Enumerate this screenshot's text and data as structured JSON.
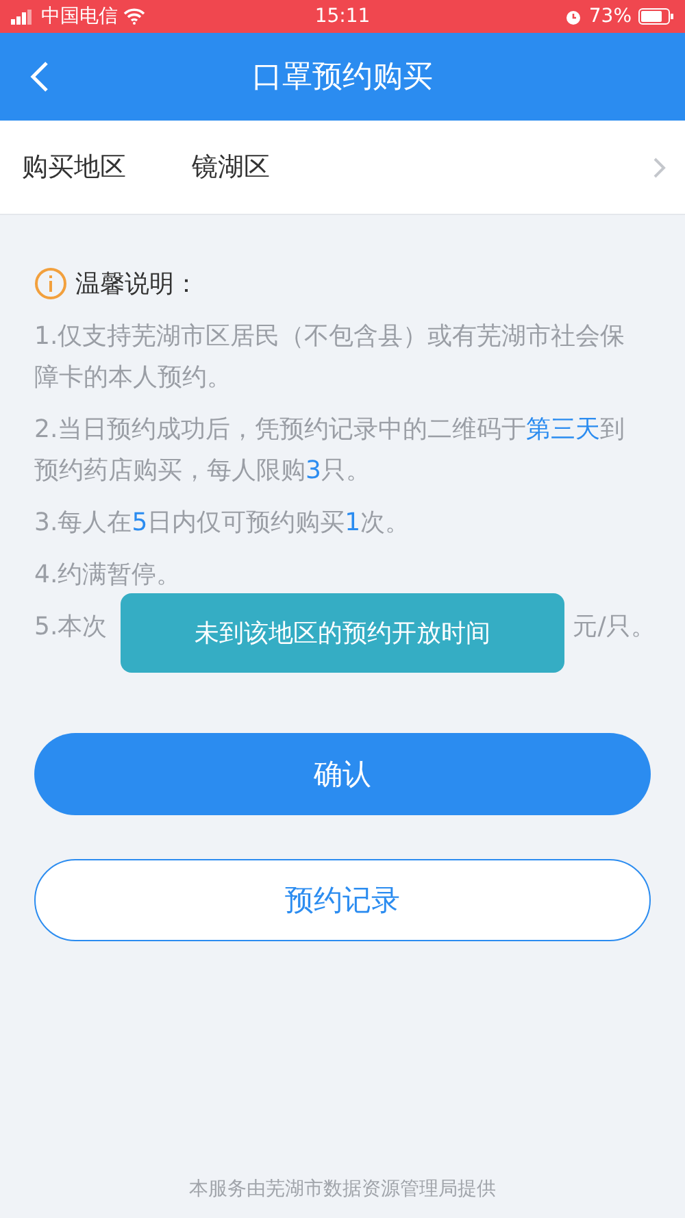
{
  "status_bar": {
    "carrier": "中国电信",
    "time": "15:11",
    "battery": "73%"
  },
  "nav_bar": {
    "title": "口罩预约购买"
  },
  "region_row": {
    "label": "购买地区",
    "value": "镜湖区"
  },
  "notice": {
    "title": "温馨说明：",
    "items": [
      {
        "segments": [
          {
            "text": "1.仅支持芜湖市区居民（不包含县）或有芜湖市社会保障卡的本人预约。",
            "highlight": false
          }
        ]
      },
      {
        "segments": [
          {
            "text": "2.当日预约成功后，凭预约记录中的二维码于",
            "highlight": false
          },
          {
            "text": "第三天",
            "highlight": true
          },
          {
            "text": "到预约药店购买，每人限购",
            "highlight": false
          },
          {
            "text": "3",
            "highlight": true
          },
          {
            "text": "只。",
            "highlight": false
          }
        ]
      },
      {
        "segments": [
          {
            "text": "3.每人在",
            "highlight": false
          },
          {
            "text": "5",
            "highlight": true
          },
          {
            "text": "日内仅可预约购买",
            "highlight": false
          },
          {
            "text": "1",
            "highlight": true
          },
          {
            "text": "次。",
            "highlight": false
          }
        ]
      },
      {
        "segments": [
          {
            "text": "4.约满暂停。",
            "highlight": false
          }
        ]
      },
      {
        "kind": "partial",
        "segments": [
          {
            "text": "5.本次",
            "highlight": false
          },
          {
            "text": "元/只。",
            "highlight": false
          }
        ]
      }
    ]
  },
  "toast": {
    "text": "未到该地区的预约开放时间"
  },
  "buttons": [
    {
      "label": "确认",
      "kind": "primary"
    },
    {
      "label": "预约记录",
      "kind": "outline"
    }
  ],
  "footer": "本服务由芜湖市数据资源管理局提供"
}
